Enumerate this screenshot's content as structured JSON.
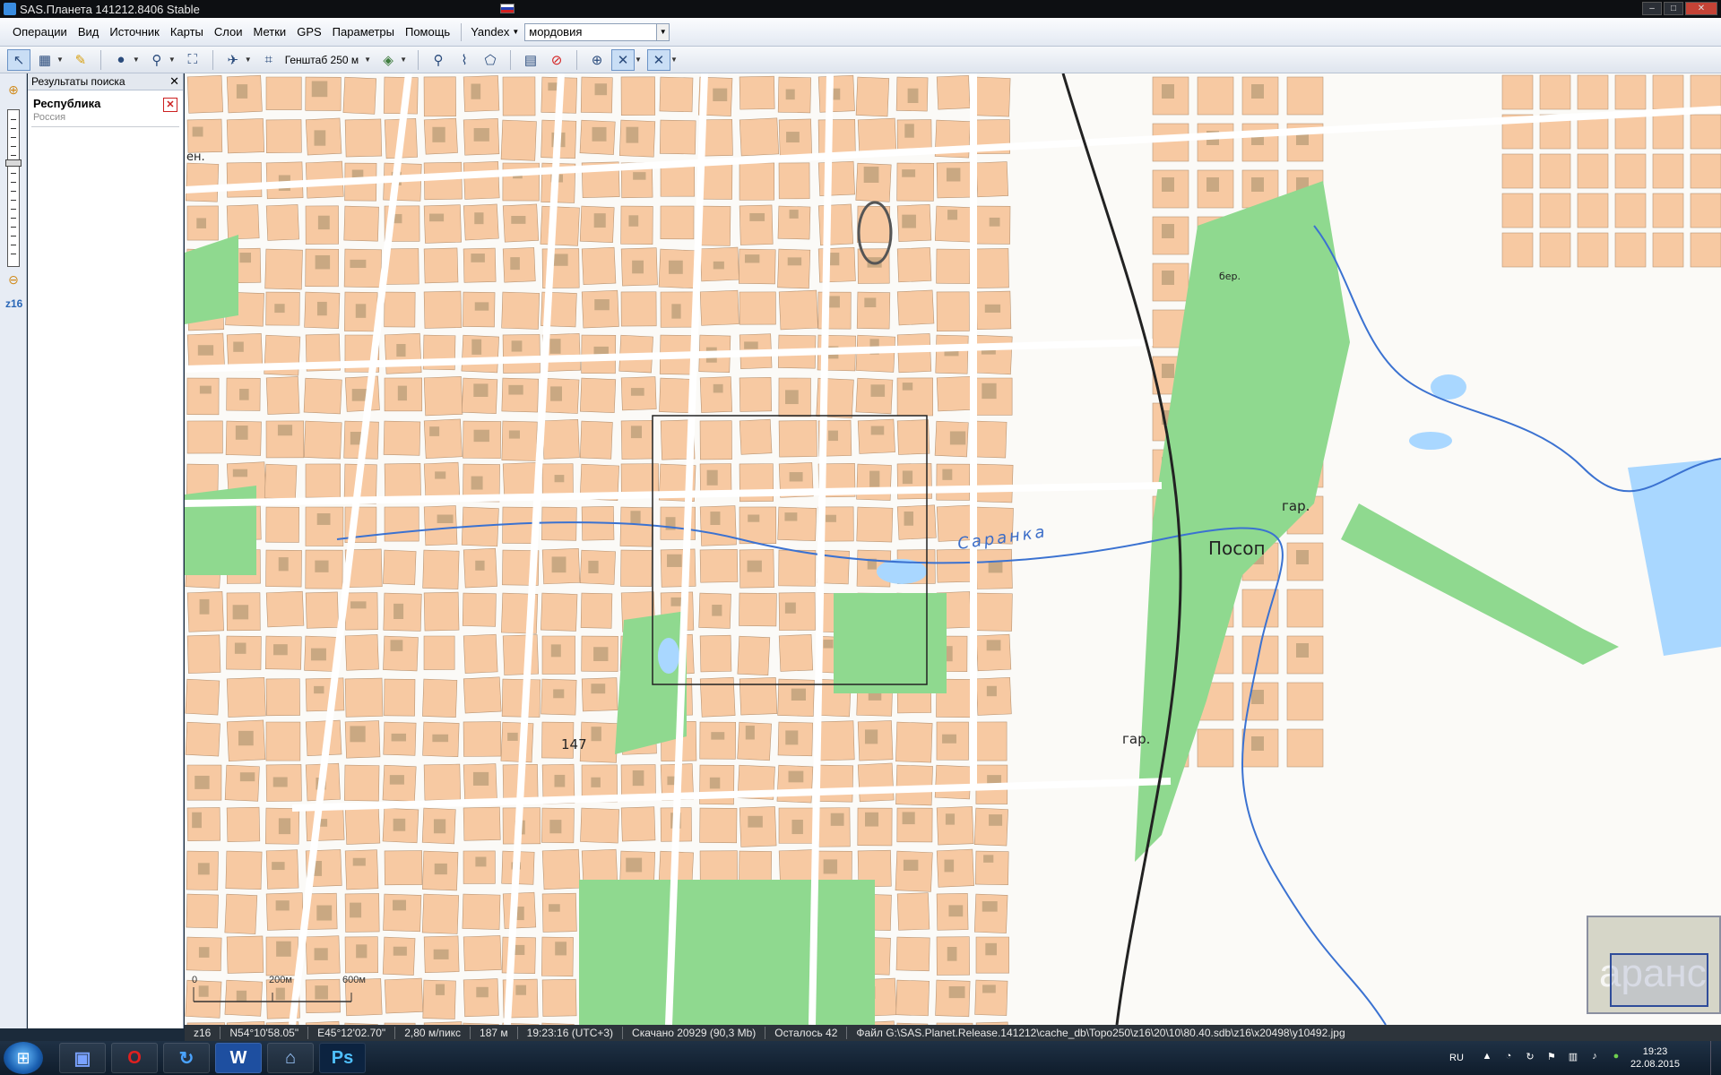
{
  "window": {
    "title": "SAS.Планета 141212.8406 Stable"
  },
  "menu": {
    "items": [
      "Операции",
      "Вид",
      "Источник",
      "Карты",
      "Слои",
      "Метки",
      "GPS",
      "Параметры",
      "Помощь"
    ],
    "search_source": "Yandex",
    "search_value": "мордовия"
  },
  "toolbar": {
    "zoom_label": "Генштаб 250 м",
    "icons": [
      "select-arrow-icon",
      "layers-icon",
      "ruler-icon",
      "globe-icon",
      "magnifier-icon",
      "fullscreen-icon",
      "satellite-icon",
      "genshtab-map-icon",
      "layers-stack-icon",
      "placemark-icon",
      "path-icon",
      "polygon-icon",
      "marks-list-icon",
      "stop-icon",
      "gps-icon",
      "gps-track-icon",
      "gps-center-icon"
    ]
  },
  "left_toolbar": {
    "zoom_level": "z16"
  },
  "search_panel": {
    "title": "Результаты поиска",
    "results": [
      {
        "title": "Республика",
        "subtitle": "Россия"
      }
    ]
  },
  "map": {
    "labels": {
      "river": "Саранка",
      "district": "Посоп",
      "garage1": "гар.",
      "garage2": "гар.",
      "shore": "бер.",
      "number": "147",
      "left_cut": "ен."
    },
    "scale": {
      "left": "0",
      "mid": "200м",
      "right": "600м"
    },
    "minimap_text": "аранс",
    "colors": {
      "building": "#f7c9a2",
      "building_dark": "#c9a882",
      "green": "#8fd98f",
      "water": "#a9d7ff",
      "river_line": "#3b72d1",
      "road": "#ffffff",
      "background": "#fbfaf7"
    }
  },
  "status": {
    "zoom": "z16",
    "lat": "N54°10'58.05\"",
    "lon": "E45°12'02.70\"",
    "resolution": "2,80 м/пикс",
    "distance": "187 м",
    "time": "19:23:16 (UTC+3)",
    "downloaded": "Скачано 20929 (90,3 Mb)",
    "remaining": "Осталось 42",
    "file": "Файл G:\\SAS.Planet.Release.141212\\cache_db\\Topo250\\z16\\20\\10\\80.40.sdb\\z16\\x20498\\y10492.jpg"
  },
  "taskbar": {
    "apps": [
      "save-app",
      "opera",
      "update",
      "word",
      "network",
      "photoshop"
    ],
    "lang": "RU",
    "time": "19:23",
    "date": "22.08.2015"
  }
}
